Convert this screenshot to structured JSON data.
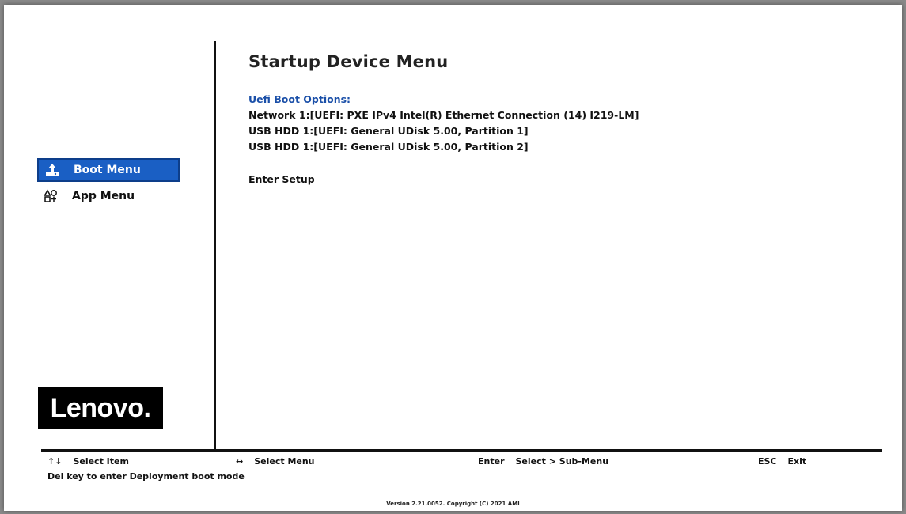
{
  "sidebar": {
    "items": [
      {
        "label": "Boot Menu",
        "icon": "boot-icon",
        "active": true
      },
      {
        "label": "App Menu",
        "icon": "app-icon",
        "active": false
      }
    ],
    "logo": "Lenovo."
  },
  "main": {
    "title": "Startup Device Menu",
    "section_label": "Uefi Boot Options:",
    "boot_options": [
      "Network 1:[UEFI: PXE IPv4 Intel(R) Ethernet Connection (14) I219-LM]",
      "USB HDD 1:[UEFI: General UDisk 5.00, Partition 1]",
      "USB HDD 1:[UEFI: General UDisk 5.00, Partition 2]"
    ],
    "enter_setup": "Enter Setup"
  },
  "footer": {
    "select_item_key": "↑↓",
    "select_item": "Select Item",
    "select_menu_key": "↔",
    "select_menu": "Select Menu",
    "enter_key": "Enter",
    "enter_action": "Select > Sub-Menu",
    "esc_key": "ESC",
    "esc_action": "Exit",
    "del_hint": "Del key to enter Deployment boot mode",
    "version": "Version 2.21.0052. Copyright (C) 2021 AMI"
  },
  "colors": {
    "accent": "#1a5fc4",
    "section_label": "#1a4fa8"
  }
}
